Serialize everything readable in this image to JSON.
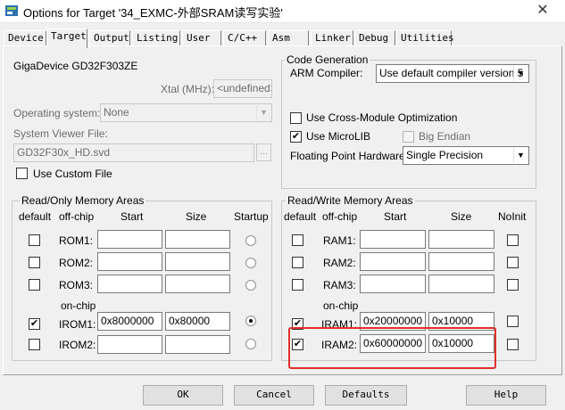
{
  "window": {
    "title": "Options for Target '34_EXMC-外部SRAM读写实验'"
  },
  "tabs": [
    "Device",
    "Target",
    "Output",
    "Listing",
    "User",
    "C/C++",
    "Asm",
    "Linker",
    "Debug",
    "Utilities"
  ],
  "device": {
    "name": "GigaDevice GD32F303ZE",
    "xtal_label": "Xtal (MHz):",
    "xtal_value": "<undefined>",
    "os_label": "Operating system:",
    "os_value": "None",
    "svf_label": "System Viewer File:",
    "svf_value": "GD32F30x_HD.svd",
    "browse_label": "...",
    "custom_file_label": "Use Custom File"
  },
  "codegen": {
    "title": "Code Generation",
    "compiler_label": "ARM Compiler:",
    "compiler_value": "Use default compiler version 5",
    "cross_module_label": "Use Cross-Module Optimization",
    "microlib_label": "Use MicroLIB",
    "big_endian_label": "Big Endian",
    "fpu_label": "Floating Point Hardware:",
    "fpu_value": "Single Precision"
  },
  "rom": {
    "title": "Read/Only Memory Areas",
    "col_default": "default",
    "col_offchip": "off-chip",
    "col_start": "Start",
    "col_size": "Size",
    "col_startup": "Startup",
    "onchip_label": "on-chip",
    "rows": [
      {
        "label": "ROM1:",
        "start": "",
        "size": ""
      },
      {
        "label": "ROM2:",
        "start": "",
        "size": ""
      },
      {
        "label": "ROM3:",
        "start": "",
        "size": ""
      },
      {
        "label": "IROM1:",
        "start": "0x8000000",
        "size": "0x80000"
      },
      {
        "label": "IROM2:",
        "start": "",
        "size": ""
      }
    ]
  },
  "ram": {
    "title": "Read/Write Memory Areas",
    "col_default": "default",
    "col_offchip": "off-chip",
    "col_start": "Start",
    "col_size": "Size",
    "col_noinit": "NoInit",
    "onchip_label": "on-chip",
    "rows": [
      {
        "label": "RAM1:",
        "start": "",
        "size": ""
      },
      {
        "label": "RAM2:",
        "start": "",
        "size": ""
      },
      {
        "label": "RAM3:",
        "start": "",
        "size": ""
      },
      {
        "label": "IRAM1:",
        "start": "0x20000000",
        "size": "0x10000"
      },
      {
        "label": "IRAM2:",
        "start": "0x60000000",
        "size": "0x10000"
      }
    ]
  },
  "buttons": {
    "ok": "OK",
    "cancel": "Cancel",
    "defaults": "Defaults",
    "help": "Help"
  },
  "colors": {
    "highlight": "#e0302a",
    "background": "#f0f0f0"
  }
}
